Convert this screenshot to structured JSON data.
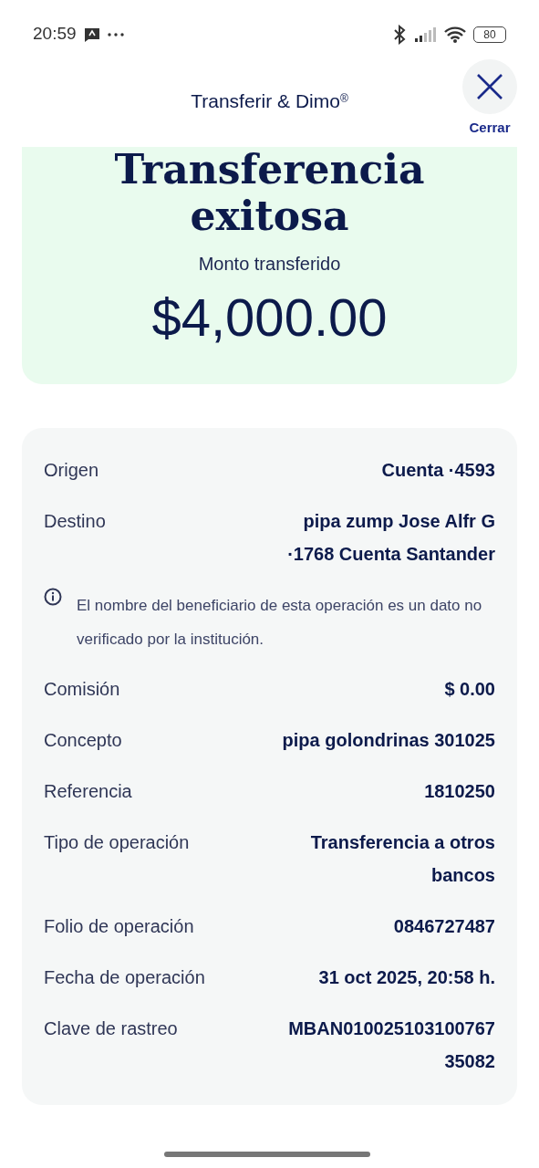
{
  "status_bar": {
    "time": "20:59",
    "battery": "80"
  },
  "header": {
    "title": "Transferir & Dimo$^{®}$",
    "close_label": "Cerrar"
  },
  "summary": {
    "title": "Transferencia exitosa",
    "amount_label": "Monto transferido",
    "amount": "$4,000.00"
  },
  "details": [
    {
      "kind": "row",
      "label": "Origen",
      "value": "Cuenta ·4593"
    },
    {
      "kind": "row",
      "label": "Destino",
      "value": "pipa zump Jose Alfr G ·1768 Cuenta Santander"
    },
    {
      "kind": "note",
      "text": "El nombre del beneficiario de esta operación es un dato no verificado por la institución."
    },
    {
      "kind": "row",
      "label": "Comisión",
      "value": "$ 0.00"
    },
    {
      "kind": "row",
      "label": "Concepto",
      "value": "pipa golondrinas 301025"
    },
    {
      "kind": "row",
      "label": "Referencia",
      "value": "1810250"
    },
    {
      "kind": "row",
      "label": "Tipo de operación",
      "value": "Transferencia a otros bancos"
    },
    {
      "kind": "row",
      "label": "Folio de operación",
      "value": "0846727487"
    },
    {
      "kind": "row",
      "label": "Fecha de operación",
      "value": "31 oct 2025, 20:58 h."
    },
    {
      "kind": "row",
      "label": "Clave de rastreo",
      "value": "MBAN010025103100767 35082"
    }
  ]
}
